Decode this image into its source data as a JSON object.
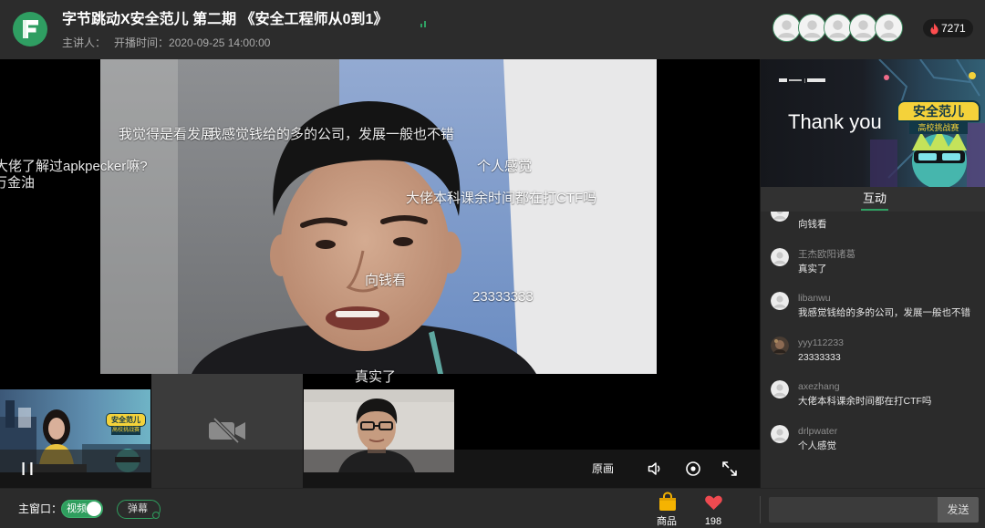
{
  "app": {
    "logo_icon": "app-logo-icon",
    "accent_color": "#2fa163"
  },
  "header": {
    "title": "字节跳动X安全范儿 第二期 《安全工程师从0到1》",
    "signal_icon": "signal-icon",
    "speaker_label": "主讲人：",
    "start_time_label": "开播时间：",
    "start_time": "2020-09-25 14:00:00",
    "viewer_avatar_icon": "default-avatar-icon",
    "popularity_icon": "fire-icon",
    "popularity": "7271"
  },
  "stage": {
    "danmaku": [
      "我觉得是看发展",
      "我感觉钱给的多的公司，发展一般也不错",
      "大佬了解过apkpecker嘛?",
      "万金油",
      "个人感觉",
      "大佬本科课余时间都在打CTF吗",
      "向钱看",
      "23333333",
      "真实了"
    ],
    "controls": {
      "pause_icon": "pause-icon",
      "quality_label": "原画",
      "volume_icon": "volume-icon",
      "record_icon": "record-icon",
      "fullscreen_icon": "fullscreen-icon"
    },
    "thumbnails": [
      {
        "type": "video",
        "camera": "on"
      },
      {
        "type": "camera-off",
        "icon": "camera-off-icon"
      },
      {
        "type": "video",
        "camera": "on"
      }
    ]
  },
  "poster": {
    "text": "Thank you",
    "logo_line1": "安全范儿",
    "logo_line2": "高校挑战赛"
  },
  "interaction": {
    "tab_label": "互动",
    "messages": [
      {
        "text": "向钱看"
      },
      {
        "user": "王杰欧阳诸葛",
        "text": "真实了"
      },
      {
        "user": "libanwu",
        "text": "我感觉钱给的多的公司，发展一般也不错"
      },
      {
        "user": "yyy112233",
        "text": "23333333"
      },
      {
        "user": "axezhang",
        "text": "大佬本科课余时间都在打CTF吗"
      },
      {
        "user": "drlpwater",
        "text": "个人感觉"
      }
    ]
  },
  "footer": {
    "main_window_label": "主窗口：",
    "video_toggle": {
      "label": "视频",
      "on": true
    },
    "danmaku_toggle": {
      "label": "弹幕",
      "on": false
    },
    "goods_icon": "shopping-bag-icon",
    "goods_label": "商品",
    "like_icon": "heart-icon",
    "likes": "198",
    "chat_input": {
      "value": "",
      "placeholder": ""
    },
    "send_label": "发送"
  },
  "colors": {
    "accent": "#2fa163",
    "fire": "#ff4d4f",
    "heart": "#ee4a50",
    "bag": "#f5b301",
    "panel_bg": "#2b2b2b"
  }
}
